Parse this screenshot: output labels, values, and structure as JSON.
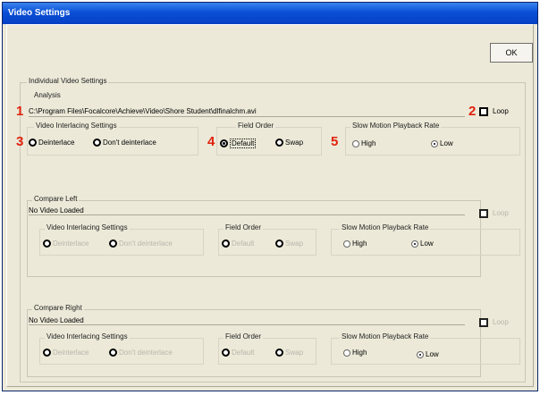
{
  "window": {
    "title": "Video Settings"
  },
  "ok_button": {
    "label": "OK"
  },
  "outer_frame": {
    "label": "Individual Video Settings"
  },
  "analysis": {
    "label": "Analysis",
    "path": "C:\\Program Files\\Focalcore\\Achieve\\Video\\Shore Student\\dlfinalchm.avi",
    "loop_label": "Loop",
    "interlacing": {
      "label": "Video Interlacing Settings",
      "options": [
        "Deinterlace",
        "Don't deinterlace"
      ]
    },
    "field_order": {
      "label": "Field Order",
      "options": [
        "Default",
        "Swap"
      ]
    },
    "slow_motion": {
      "label": "Slow Motion Playback Rate",
      "options": [
        "High",
        "Low"
      ]
    }
  },
  "compare_left": {
    "label": "Compare Left",
    "path": "No Video Loaded",
    "loop_label": "Loop",
    "interlacing": {
      "label": "Video Interlacing Settings",
      "options": [
        "Deinterlace",
        "Don't deinterlace"
      ]
    },
    "field_order": {
      "label": "Field Order",
      "options": [
        "Default",
        "Swap"
      ]
    },
    "slow_motion": {
      "label": "Slow Motion Playback Rate",
      "options": [
        "High",
        "Low"
      ]
    }
  },
  "compare_right": {
    "label": "Compare Right",
    "path": "No Video Loaded",
    "loop_label": "Loop",
    "interlacing": {
      "label": "Video Interlacing Settings",
      "options": [
        "Deinterlace",
        "Don't deinterlace"
      ]
    },
    "field_order": {
      "label": "Field Order",
      "options": [
        "Default",
        "Swap"
      ]
    },
    "slow_motion": {
      "label": "Slow Motion Playback Rate",
      "options": [
        "High",
        "Low"
      ]
    }
  },
  "callouts": [
    "1",
    "2",
    "3",
    "4",
    "5"
  ],
  "colors": {
    "callout": "#e0200c",
    "titlebar": "#0a4fd6",
    "dialog": "#ece9d8"
  }
}
